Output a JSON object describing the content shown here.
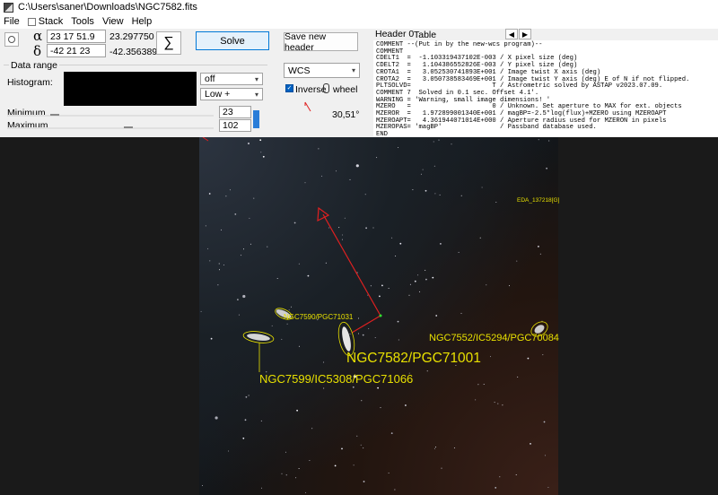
{
  "window": {
    "title": "C:\\Users\\saner\\Downloads\\NGC7582.fits"
  },
  "menu": [
    "File",
    "Stack",
    "Tools",
    "View",
    "Help"
  ],
  "coords": {
    "alpha_symbol": "α",
    "delta_symbol": "δ",
    "ra_input": "23 17 51.9",
    "dec_input": "-42 21 23",
    "ra_decimal": "23.297750",
    "dec_decimal": "-42.356389"
  },
  "buttons": {
    "sigma": "∑",
    "solve": "Solve",
    "save_header": "Save new header"
  },
  "data_range": {
    "title": "Data range",
    "histogram_label": "Histogram:",
    "mode_select": "off",
    "scale_select": "Low +",
    "minimum_label": "Minimum",
    "maximum_label": "Maximum",
    "minimum_value": "23",
    "maximum_value": "102"
  },
  "wcs": {
    "select": "WCS",
    "inverse_label": "Inverse",
    "wheel_label": "wheel",
    "angle": "30,51°"
  },
  "header_tabs": {
    "header": "Header 0",
    "table": "Table"
  },
  "header_lines": [
    "COMMENT --(Put in by the new-wcs program)--",
    "COMMENT",
    "CDELT1  =  -1.103319437102E-003 / X pixel size (deg)",
    "CDELT2  =   1.104386552826E-003 / Y pixel size (deg)",
    "CROTA1  =   3.052530741893E+001 / Image twist X axis (deg)",
    "CROTA2  =   3.050738583469E+001 / Image twist Y axis (deg) E of N if not flipped.",
    "PLTSOLVD=                     T / Astrometric solved by ASTAP v2023.07.09.",
    "COMMENT 7  Solved in 0.1 sec. Offset 4.1'.",
    "WARNING = 'Warning, small image dimensions! '",
    "MZERO   =                     0 / Unknown. Set aperture to MAX for ext. objects",
    "MZEROR  =   1.972899001340E+001 / magBP=-2.5*log(flux)+MZERO using MZEROAPT",
    "MZEROAPT=   4.361944071014E+000 / Aperture radius used for MZERON in pixels",
    "MZEROPAS= 'magBP'               / Passband database used.",
    "END"
  ],
  "annotations": {
    "eda": "EDA_137218[G]",
    "ngc7590": "NGC7590/PGC71031",
    "ngc7552": "NGC7552/IC5294/PGC70084",
    "ngc7582": "NGC7582/PGC71001",
    "ngc7599": "NGC7599/IC5308/PGC71066"
  },
  "colors": {
    "annotation": "#e8e000",
    "arrow": "#e02020",
    "solve_border": "#0078d7"
  }
}
